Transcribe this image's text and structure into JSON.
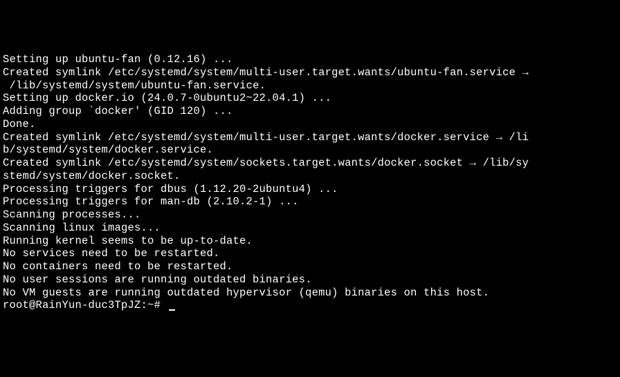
{
  "terminal": {
    "lines": [
      "Setting up ubuntu-fan (0.12.16) ...",
      "Created symlink /etc/systemd/system/multi-user.target.wants/ubuntu-fan.service →",
      " /lib/systemd/system/ubuntu-fan.service.",
      "Setting up docker.io (24.0.7-0ubuntu2~22.04.1) ...",
      "Adding group `docker' (GID 120) ...",
      "Done.",
      "Created symlink /etc/systemd/system/multi-user.target.wants/docker.service → /li",
      "b/systemd/system/docker.service.",
      "Created symlink /etc/systemd/system/sockets.target.wants/docker.socket → /lib/sy",
      "stemd/system/docker.socket.",
      "Processing triggers for dbus (1.12.20-2ubuntu4) ...",
      "Processing triggers for man-db (2.10.2-1) ...",
      "Scanning processes...",
      "Scanning linux images...",
      "",
      "Running kernel seems to be up-to-date.",
      "",
      "No services need to be restarted.",
      "",
      "No containers need to be restarted.",
      "",
      "No user sessions are running outdated binaries.",
      "",
      "No VM guests are running outdated hypervisor (qemu) binaries on this host."
    ],
    "prompt": "root@RainYun-duc3TpJZ:~# "
  }
}
